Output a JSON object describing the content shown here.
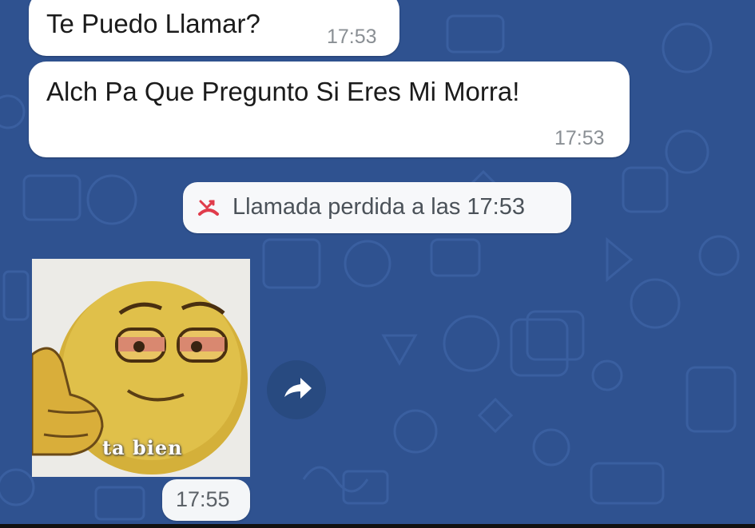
{
  "messages": [
    {
      "text": "Te Puedo Llamar?",
      "time": "17:53"
    },
    {
      "text": "Alch Pa Que Pregunto  Si Eres Mi Morra!",
      "time": "17:53"
    }
  ],
  "system_event": {
    "icon": "missed-call-icon",
    "label": "Llamada perdida a las 17:53",
    "icon_color": "#e03c4b"
  },
  "sticker": {
    "caption": "ta bien",
    "time": "17:55"
  },
  "forward": {
    "icon": "forward-arrow-icon"
  },
  "colors": {
    "wallpaper": "#2f5290",
    "bubble": "#ffffff",
    "timestamp": "#8a8f94"
  }
}
